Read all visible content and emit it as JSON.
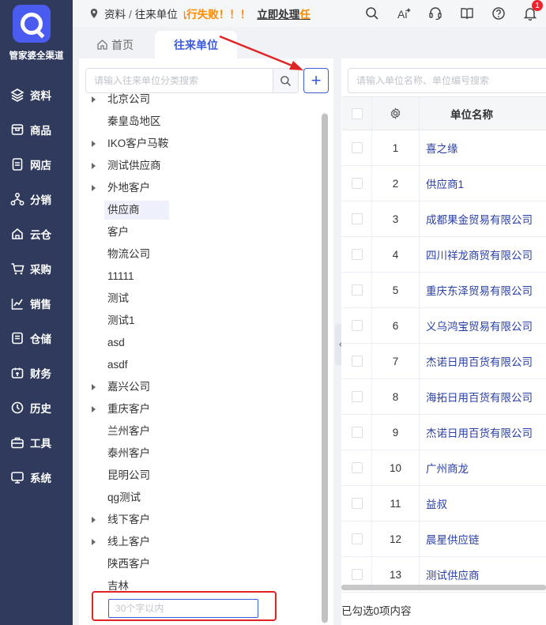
{
  "brand": "管家婆全渠道",
  "nav": [
    {
      "label": "资料",
      "icon": "layers-icon"
    },
    {
      "label": "商品",
      "icon": "box-icon"
    },
    {
      "label": "网店",
      "icon": "document-icon"
    },
    {
      "label": "分销",
      "icon": "network-icon"
    },
    {
      "label": "云仓",
      "icon": "cloud-warehouse-icon"
    },
    {
      "label": "采购",
      "icon": "cart-icon"
    },
    {
      "label": "销售",
      "icon": "chart-icon"
    },
    {
      "label": "仓储",
      "icon": "storage-icon"
    },
    {
      "label": "财务",
      "icon": "finance-icon"
    },
    {
      "label": "历史",
      "icon": "history-icon"
    },
    {
      "label": "工具",
      "icon": "toolbox-icon"
    },
    {
      "label": "系统",
      "icon": "monitor-icon"
    }
  ],
  "topbar": {
    "crumb_root": "资料",
    "crumb_current": "往来单位",
    "alert": "执行失败！！！",
    "handle": "立即处理",
    "handle_tail": "任",
    "notification_count": "1"
  },
  "tabs": {
    "home": "首页",
    "active": "往来单位"
  },
  "tree": {
    "search_placeholder": "请输入往来单位分类搜索",
    "add_label": "+",
    "items": [
      {
        "label": "北京公司",
        "arrow": true
      },
      {
        "label": "秦皇岛地区",
        "arrow": false
      },
      {
        "label": "IKO客户马鞍",
        "arrow": true
      },
      {
        "label": "测试供应商",
        "arrow": true
      },
      {
        "label": "外地客户",
        "arrow": true
      },
      {
        "label": "供应商",
        "arrow": false,
        "selected": true
      },
      {
        "label": "客户",
        "arrow": false
      },
      {
        "label": "物流公司",
        "arrow": false
      },
      {
        "label": "11111",
        "arrow": false
      },
      {
        "label": "测试",
        "arrow": false
      },
      {
        "label": "测试1",
        "arrow": false
      },
      {
        "label": "asd",
        "arrow": false
      },
      {
        "label": "asdf",
        "arrow": false
      },
      {
        "label": "嘉兴公司",
        "arrow": true
      },
      {
        "label": "重庆客户",
        "arrow": true
      },
      {
        "label": "兰州客户",
        "arrow": false
      },
      {
        "label": "泰州客户",
        "arrow": false
      },
      {
        "label": "昆明公司",
        "arrow": false
      },
      {
        "label": "qg测试",
        "arrow": false
      },
      {
        "label": "线下客户",
        "arrow": true
      },
      {
        "label": "线上客户",
        "arrow": true
      },
      {
        "label": "陕西客户",
        "arrow": false
      },
      {
        "label": "吉林",
        "arrow": false
      }
    ],
    "new_item_placeholder": "30个字以内"
  },
  "units": {
    "search_placeholder": "请输入单位名称、单位编号搜索",
    "col_name": "单位名称",
    "rows": [
      {
        "idx": "1",
        "name": "喜之缘"
      },
      {
        "idx": "2",
        "name": "供应商1"
      },
      {
        "idx": "3",
        "name": "成都果金贸易有限公司"
      },
      {
        "idx": "4",
        "name": "四川祥龙商贸有限公司"
      },
      {
        "idx": "5",
        "name": "重庆东泽贸易有限公司"
      },
      {
        "idx": "6",
        "name": "义乌鸿宝贸易有限公司"
      },
      {
        "idx": "7",
        "name": "杰诺日用百货有限公司"
      },
      {
        "idx": "8",
        "name": "海拓日用百货有限公司"
      },
      {
        "idx": "9",
        "name": "杰诺日用百货有限公司"
      },
      {
        "idx": "10",
        "name": "广州商龙"
      },
      {
        "idx": "11",
        "name": "益叔"
      },
      {
        "idx": "12",
        "name": "晨星供应链"
      },
      {
        "idx": "13",
        "name": "测试供应商"
      }
    ],
    "footer": "已勾选0项内容"
  },
  "colors": {
    "sidebar": "#2f3a5c",
    "accent": "#3b5bdb",
    "alert": "#ff8a00",
    "highlight": "#e02424"
  }
}
